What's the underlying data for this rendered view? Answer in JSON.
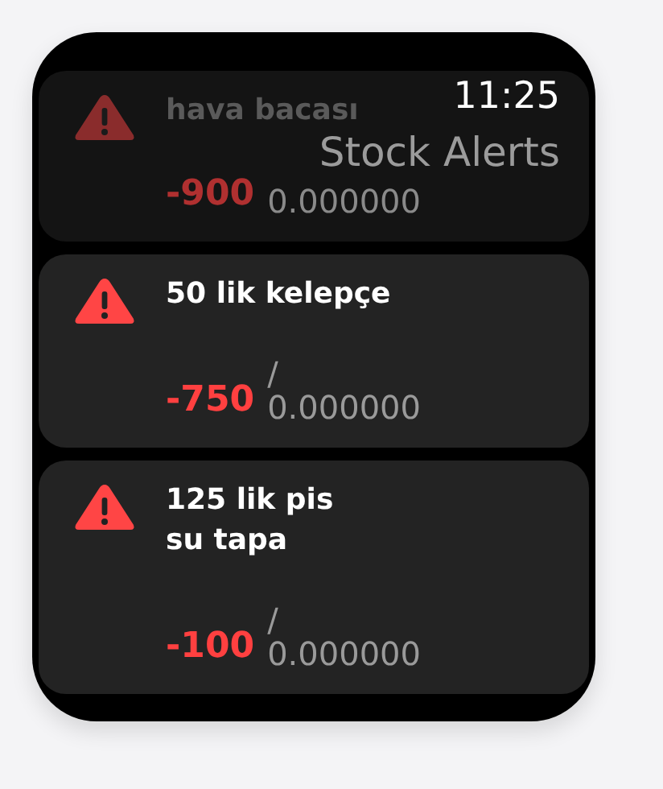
{
  "status": {
    "time": "11:25",
    "title": "Stock Alerts"
  },
  "alerts": [
    {
      "name": "hava bacası",
      "quantity": "-900",
      "reading": "0.000000",
      "dimmed": true
    },
    {
      "name": "50 lik kelepçe",
      "quantity": "-750",
      "separator": "/",
      "reading": "0.000000",
      "dimmed": false
    },
    {
      "name": "125 lik pis\nsu tapa",
      "quantity": "-100",
      "separator": "/",
      "reading": "0.000000",
      "dimmed": false
    }
  ]
}
